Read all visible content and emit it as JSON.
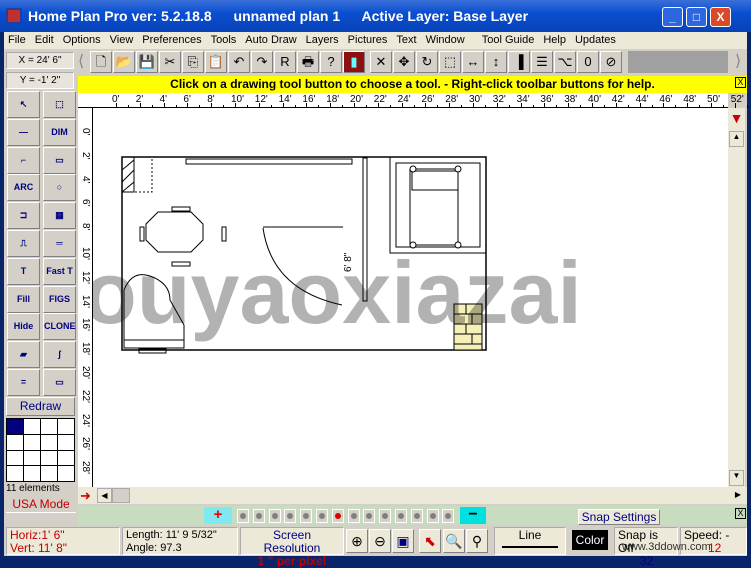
{
  "window": {
    "app": "Home Plan Pro ver: 5.2.18.8",
    "plan": "unnamed plan 1",
    "layer": "Active Layer: Base Layer",
    "minimize": "_",
    "maximize": "□",
    "close": "X"
  },
  "menu": [
    "File",
    "Edit",
    "Options",
    "View",
    "Preferences",
    "Tools",
    "Auto Draw",
    "Layers",
    "Pictures",
    "Text",
    "Window",
    "Tool Guide",
    "Help",
    "Updates"
  ],
  "coords": {
    "x": "X = 24' 6\"",
    "y": "Y = -1' 2\""
  },
  "toolbar_icons": [
    "new-file",
    "open-folder",
    "save",
    "cut",
    "copy",
    "paste",
    "undo",
    "redo",
    "report",
    "print",
    "help",
    "door",
    "delete",
    "move",
    "rotate",
    "select-area",
    "resize-horizontal",
    "resize-vertical",
    "wall",
    "lines",
    "node-edit",
    "undo-zero",
    "cancel"
  ],
  "hint": "Click on a drawing tool button to choose a tool.  -  Right-click toolbar buttons for help.",
  "hint_close": "X",
  "ruler_h": [
    "0'",
    "2'",
    "4'",
    "6'",
    "8'",
    "10'",
    "12'",
    "14'",
    "16'",
    "18'",
    "20'",
    "22'",
    "24'",
    "26'",
    "28'",
    "30'",
    "32'",
    "34'",
    "36'",
    "38'",
    "40'",
    "42'",
    "44'",
    "46'",
    "48'",
    "50'",
    "52'"
  ],
  "ruler_v": [
    "0'",
    "2'",
    "4'",
    "6'",
    "8'",
    "10'",
    "12'",
    "14'",
    "16'",
    "18'",
    "20'",
    "22'",
    "24'",
    "26'",
    "28'"
  ],
  "tools": [
    [
      "↖",
      "⬚"
    ],
    [
      "—",
      "DIM"
    ],
    [
      "⌐",
      "▭"
    ],
    [
      "ARC",
      "○"
    ],
    [
      "⊐",
      "▦"
    ],
    [
      "⎍",
      "═"
    ],
    [
      "T",
      "Fast T"
    ],
    [
      "Fill",
      "FIGS"
    ],
    [
      "Hide",
      "CLONE"
    ],
    [
      "▰",
      "ʃ"
    ],
    [
      "=",
      "▭"
    ]
  ],
  "redraw": "Redraw",
  "element_count": "11 elements",
  "mode": "USA Mode",
  "plan": {
    "dimension_label": "6' 8\""
  },
  "watermark": "ouyaoxiazai",
  "layer_bar": {
    "add": "+",
    "remove": "−",
    "active_index": 6,
    "count": 14
  },
  "snap_settings": "Snap Settings",
  "status": {
    "horiz": "Horiz:1' 6\"",
    "vert": "Vert: 11' 8\"",
    "length": "Length: 11' 9 5/32\"",
    "angle": "Angle:  97.3",
    "res_title": "Screen Resolution",
    "res_value": "1 \" per pixel",
    "line": "Line",
    "color": "Color",
    "snap": "Snap is Off",
    "snap_val": "32",
    "speed": "Speed:",
    "speed_val": "12",
    "speed_minus": "-",
    "site": "www.3ddown.com"
  },
  "colors": {
    "hint": "#ffff00",
    "title": "#0a4fd0",
    "status_red": "#c00000"
  }
}
